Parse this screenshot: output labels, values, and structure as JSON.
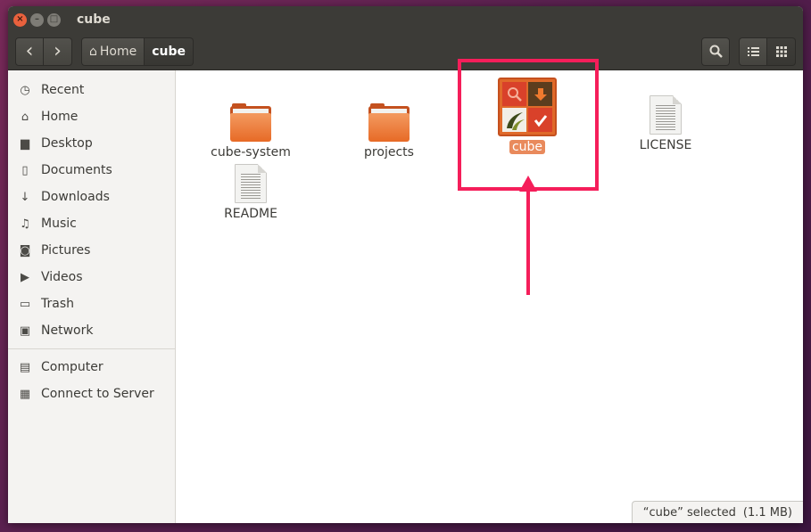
{
  "window": {
    "title": "cube"
  },
  "toolbar": {
    "back_glyph": "‹",
    "forward_glyph": "›",
    "breadcrumbs": [
      {
        "label": "Home",
        "icon": "home-icon"
      },
      {
        "label": "cube"
      }
    ]
  },
  "sidebar": {
    "items": [
      {
        "label": "Recent",
        "icon": "clock-icon"
      },
      {
        "label": "Home",
        "icon": "home-icon"
      },
      {
        "label": "Desktop",
        "icon": "folder-icon"
      },
      {
        "label": "Documents",
        "icon": "document-icon"
      },
      {
        "label": "Downloads",
        "icon": "download-icon"
      },
      {
        "label": "Music",
        "icon": "music-icon"
      },
      {
        "label": "Pictures",
        "icon": "camera-icon"
      },
      {
        "label": "Videos",
        "icon": "video-icon"
      },
      {
        "label": "Trash",
        "icon": "trash-icon"
      },
      {
        "label": "Network",
        "icon": "network-icon"
      }
    ],
    "devices": [
      {
        "label": "Computer",
        "icon": "computer-icon"
      },
      {
        "label": "Connect to Server",
        "icon": "server-icon"
      }
    ]
  },
  "files": [
    {
      "name": "cube-system",
      "type": "folder"
    },
    {
      "name": "projects",
      "type": "folder"
    },
    {
      "name": "cube",
      "type": "app",
      "selected": true
    },
    {
      "name": "LICENSE",
      "type": "text"
    },
    {
      "name": "README",
      "type": "text"
    }
  ],
  "status": {
    "selected": "“cube” selected",
    "size": "(1.1 MB)"
  },
  "colors": {
    "accent": "#e98a5c",
    "annotation": "#f51e5a",
    "titlebar": "#3c3b37"
  }
}
